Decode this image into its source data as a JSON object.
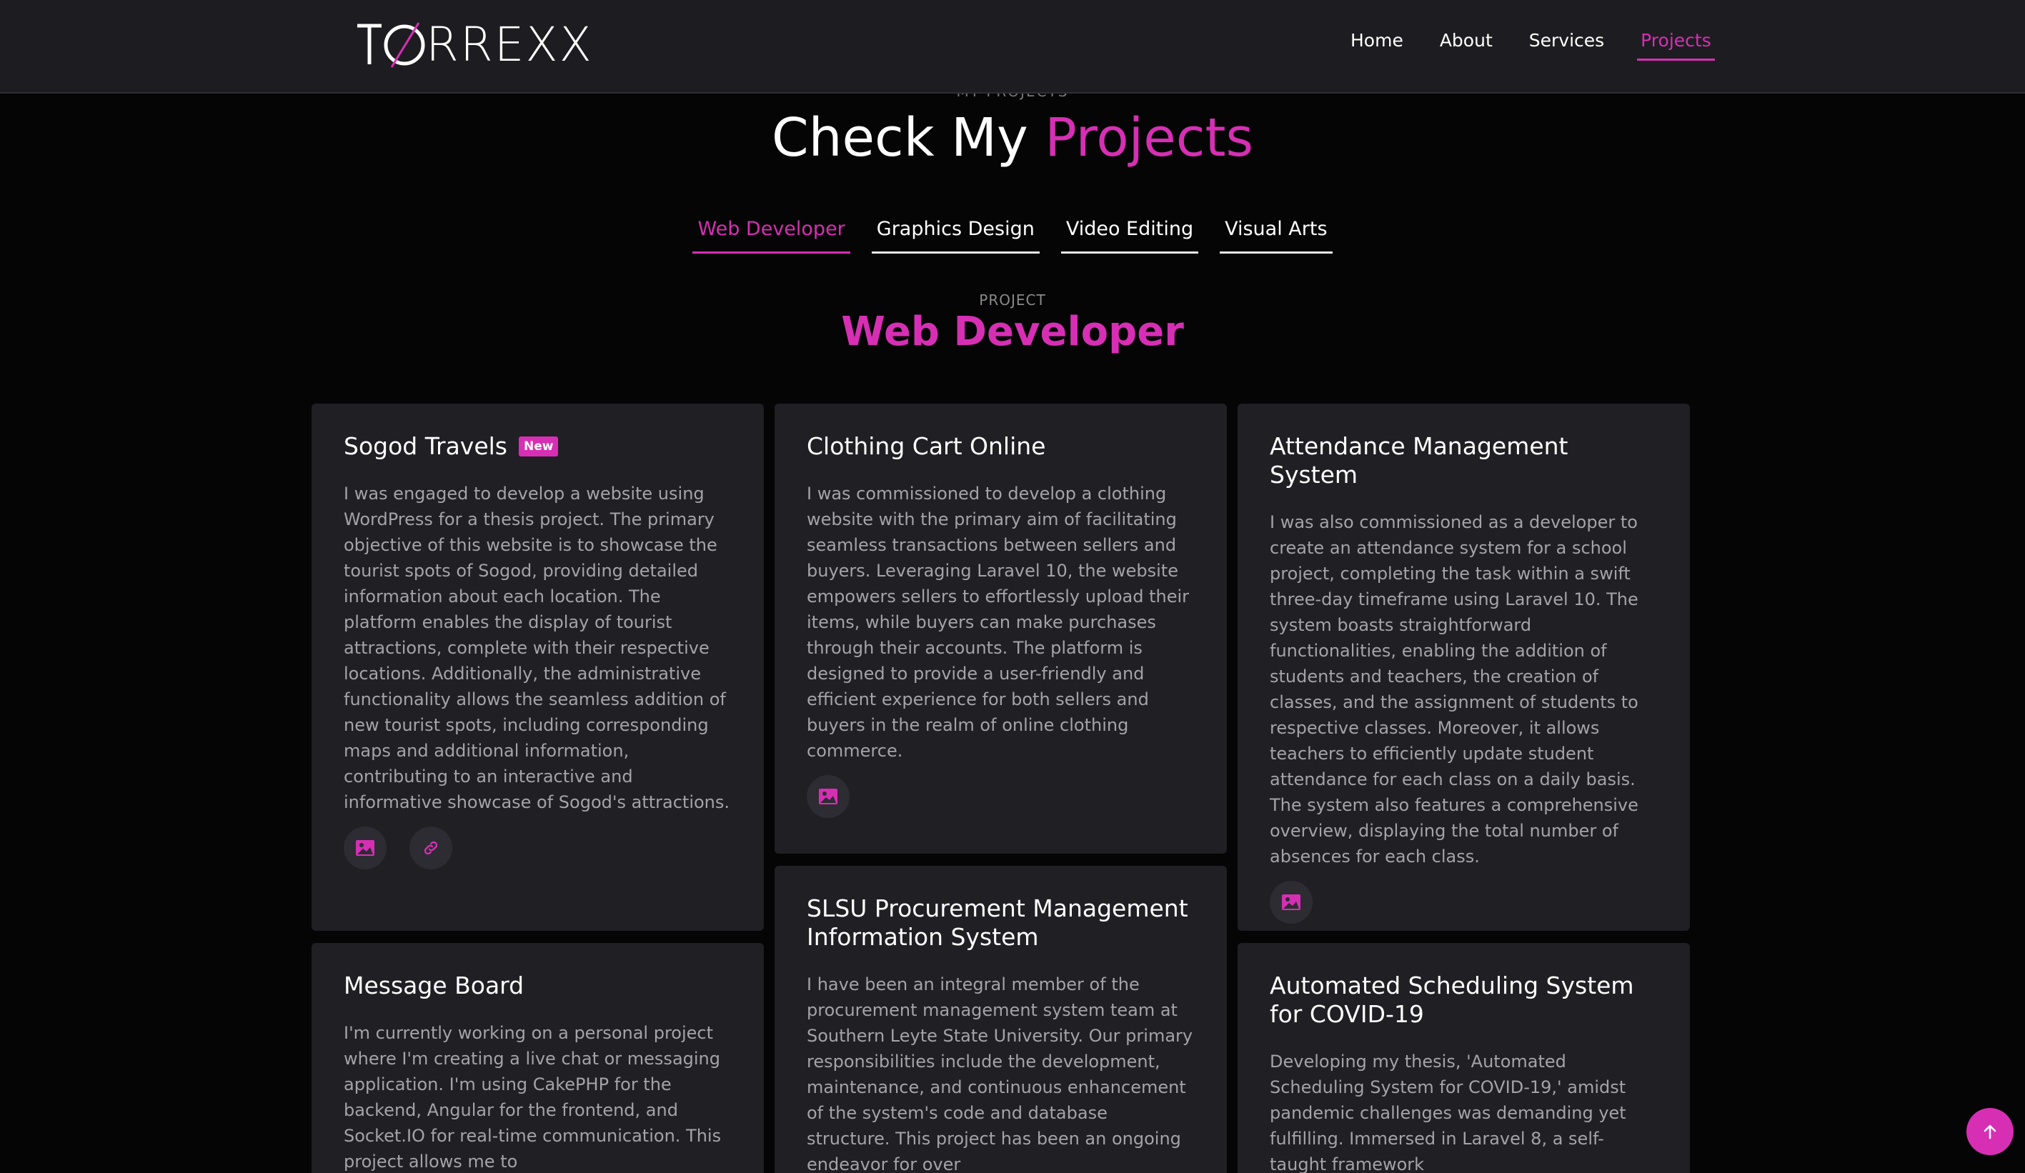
{
  "header": {
    "logo_text": "TORREXX",
    "nav": [
      {
        "label": "Home",
        "active": false
      },
      {
        "label": "About",
        "active": false
      },
      {
        "label": "Services",
        "active": false
      },
      {
        "label": "Projects",
        "active": true
      }
    ]
  },
  "section": {
    "eyebrow": "MY PROJECTS",
    "title_plain": "Check My ",
    "title_accent": "Projects"
  },
  "tabs": [
    {
      "label": "Web Developer",
      "active": true
    },
    {
      "label": "Graphics Design",
      "active": false
    },
    {
      "label": "Video Editing",
      "active": false
    },
    {
      "label": "Visual Arts",
      "active": false
    }
  ],
  "category": {
    "eyebrow": "PROJECT",
    "title": "Web Developer"
  },
  "projects": [
    {
      "title": "Sogod Travels",
      "badge": "New",
      "description": "I was engaged to develop a website using WordPress for a thesis project. The primary objective of this website is to showcase the tourist spots of Sogod, providing detailed information about each location. The platform enables the display of tourist attractions, complete with their respective locations. Additionally, the administrative functionality allows the seamless addition of new tourist spots, including corresponding maps and additional information, contributing to an interactive and informative showcase of Sogod's attractions."
    },
    {
      "title": "Clothing Cart Online",
      "description": "I was commissioned to develop a clothing website with the primary aim of facilitating seamless transactions between sellers and buyers. Leveraging Laravel 10, the website empowers sellers to effortlessly upload their items, while buyers can make purchases through their accounts. The platform is designed to provide a user-friendly and efficient experience for both sellers and buyers in the realm of online clothing commerce."
    },
    {
      "title": "Attendance Management System",
      "description": "I was also commissioned as a developer to create an attendance system for a school project, completing the task within a swift three-day timeframe using Laravel 10. The system boasts straightforward functionalities, enabling the addition of students and teachers, the creation of classes, and the assignment of students to respective classes. Moreover, it allows teachers to efficiently update student attendance for each class on a daily basis. The system also features a comprehensive overview, displaying the total number of absences for each class."
    },
    {
      "title": "Message Board",
      "description": "I'm currently working on a personal project where I'm creating a live chat or messaging application. I'm using CakePHP for the backend, Angular for the frontend, and Socket.IO for real-time communication. This project allows me to"
    },
    {
      "title": "SLSU Procurement Management Information System",
      "description": "I have been an integral member of the procurement management system team at Southern Leyte State University. Our primary responsibilities include the development, maintenance, and continuous enhancement of the system's code and database structure. This project has been an ongoing endeavor for over"
    },
    {
      "title": "Automated Scheduling System for COVID-19",
      "description": "Developing my thesis, 'Automated Scheduling System for COVID-19,' amidst pandemic challenges was demanding yet fulfilling. Immersed in Laravel 8, a self-taught framework"
    }
  ],
  "icons": {
    "image": "image-icon",
    "link": "link-icon",
    "scroll_top": "arrow-up-icon"
  },
  "colors": {
    "accent": "#d62fb4",
    "background": "#050505",
    "header_bg": "#1d1d21",
    "card_bg": "#1f1f24"
  }
}
